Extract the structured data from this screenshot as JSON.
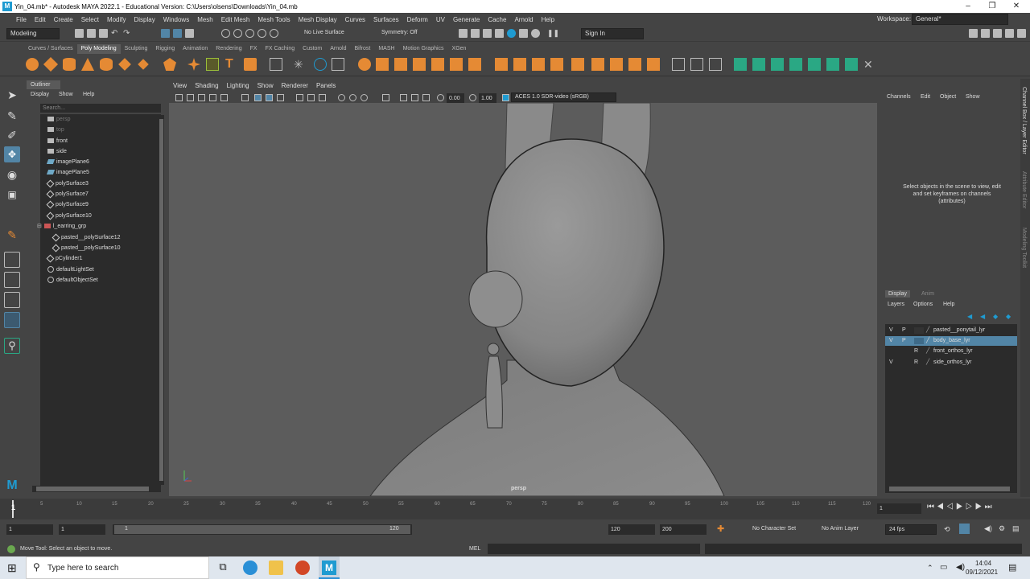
{
  "window": {
    "title": "Yin_04.mb* - Autodesk MAYA 2022.1 - Educational Version: C:\\Users\\olsens\\Downloads\\Yin_04.mb",
    "controls": [
      "–",
      "❐",
      "✕"
    ]
  },
  "menubar": [
    "File",
    "Edit",
    "Create",
    "Select",
    "Modify",
    "Display",
    "Windows",
    "Mesh",
    "Edit Mesh",
    "Mesh Tools",
    "Mesh Display",
    "Curves",
    "Surfaces",
    "Deform",
    "UV",
    "Generate",
    "Cache",
    "Arnold",
    "Help"
  ],
  "workspace": {
    "label": "Workspace:",
    "value": "General*"
  },
  "statusline": {
    "mode": "Modeling",
    "live_surface": "No Live Surface",
    "symmetry": "Symmetry: Off",
    "sign_in": "Sign In"
  },
  "shelf_tabs": [
    "Curves / Surfaces",
    "Poly Modeling",
    "Sculpting",
    "Rigging",
    "Animation",
    "Rendering",
    "FX",
    "FX Caching",
    "Custom",
    "Arnold",
    "Bifrost",
    "MASH",
    "Motion Graphics",
    "XGen"
  ],
  "active_shelf_tab": "Poly Modeling",
  "outliner": {
    "title": "Outliner",
    "menu": [
      "Display",
      "Show",
      "Help"
    ],
    "search_placeholder": "Search...",
    "items": [
      {
        "label": "persp",
        "icon": "camera-icon",
        "dim": true
      },
      {
        "label": "top",
        "icon": "camera-icon",
        "dim": true
      },
      {
        "label": "front",
        "icon": "camera-icon",
        "dim": false
      },
      {
        "label": "side",
        "icon": "camera-icon",
        "dim": false
      },
      {
        "label": "imagePlane6",
        "icon": "image-plane-icon",
        "dim": false
      },
      {
        "label": "imagePlane5",
        "icon": "image-plane-icon",
        "dim": false
      },
      {
        "label": "polySurface3",
        "icon": "mesh-icon",
        "dim": false
      },
      {
        "label": "polySurface7",
        "icon": "mesh-icon",
        "dim": false
      },
      {
        "label": "polySurface9",
        "icon": "mesh-icon",
        "dim": false
      },
      {
        "label": "polySurface10",
        "icon": "mesh-icon",
        "dim": false
      },
      {
        "label": "l_earring_grp",
        "icon": "group-icon",
        "dim": false
      },
      {
        "label": "pasted__polySurface12",
        "icon": "mesh-icon",
        "dim": false
      },
      {
        "label": "pasted__polySurface10",
        "icon": "mesh-icon",
        "dim": false
      },
      {
        "label": "pCylinder1",
        "icon": "mesh-icon",
        "dim": false
      },
      {
        "label": "defaultLightSet",
        "icon": "set-icon",
        "dim": false
      },
      {
        "label": "defaultObjectSet",
        "icon": "set-icon",
        "dim": false
      }
    ]
  },
  "viewport": {
    "menu": [
      "View",
      "Shading",
      "Lighting",
      "Show",
      "Renderer",
      "Panels"
    ],
    "exposure": "0.00",
    "gamma": "1.00",
    "color_space": "ACES 1.0 SDR-video (sRGB)",
    "camera_label": "persp"
  },
  "channelbox": {
    "menu": [
      "Channels",
      "Edit",
      "Object",
      "Show"
    ],
    "message": "Select objects in the scene to view, edit and set keyframes on channels (attributes)",
    "side_tabs": [
      "Channel Box / Layer Editor",
      "Attribute Editor",
      "Modeling Toolkit"
    ]
  },
  "layer_editor": {
    "tabs": [
      "Display",
      "Anim"
    ],
    "menu": [
      "Layers",
      "Options",
      "Help"
    ],
    "layers": [
      {
        "v": "V",
        "p": "P",
        "name": "pasted__ponytail_lyr",
        "selected": false
      },
      {
        "v": "V",
        "p": "P",
        "name": "body_base_lyr",
        "selected": true
      },
      {
        "v": "",
        "p": "R",
        "name": "front_orthos_lyr",
        "selected": false
      },
      {
        "v": "V",
        "p": "R",
        "name": "side_orthos_lyr",
        "selected": false
      }
    ]
  },
  "timeslider": {
    "ticks": [
      "1",
      "5",
      "10",
      "15",
      "20",
      "25",
      "30",
      "35",
      "40",
      "45",
      "50",
      "55",
      "60",
      "65",
      "70",
      "75",
      "80",
      "85",
      "90",
      "95",
      "100",
      "105",
      "110",
      "115",
      "120"
    ],
    "current_frame": "1"
  },
  "rangeslider": {
    "start": "1",
    "start2": "1",
    "range_start": "1",
    "range_end": "120",
    "end": "120",
    "end2": "200",
    "character_set": "No Character Set",
    "anim_layer": "No Anim Layer",
    "fps": "24 fps"
  },
  "helpline": {
    "text": "Move Tool: Select an object to move.",
    "script_lang": "MEL"
  },
  "taskbar": {
    "search_placeholder": "Type here to search",
    "time": "14:04",
    "date": "09/12/2021"
  },
  "colors": {
    "panel": "#444444",
    "dark_field": "#2b2b2b",
    "viewport_bg": "#5c5c5c",
    "model": "#8a8a8a",
    "shelf_orange": "#e58a34",
    "selection_blue": "#5285a6",
    "maya_teal": "#1f9bd1"
  }
}
